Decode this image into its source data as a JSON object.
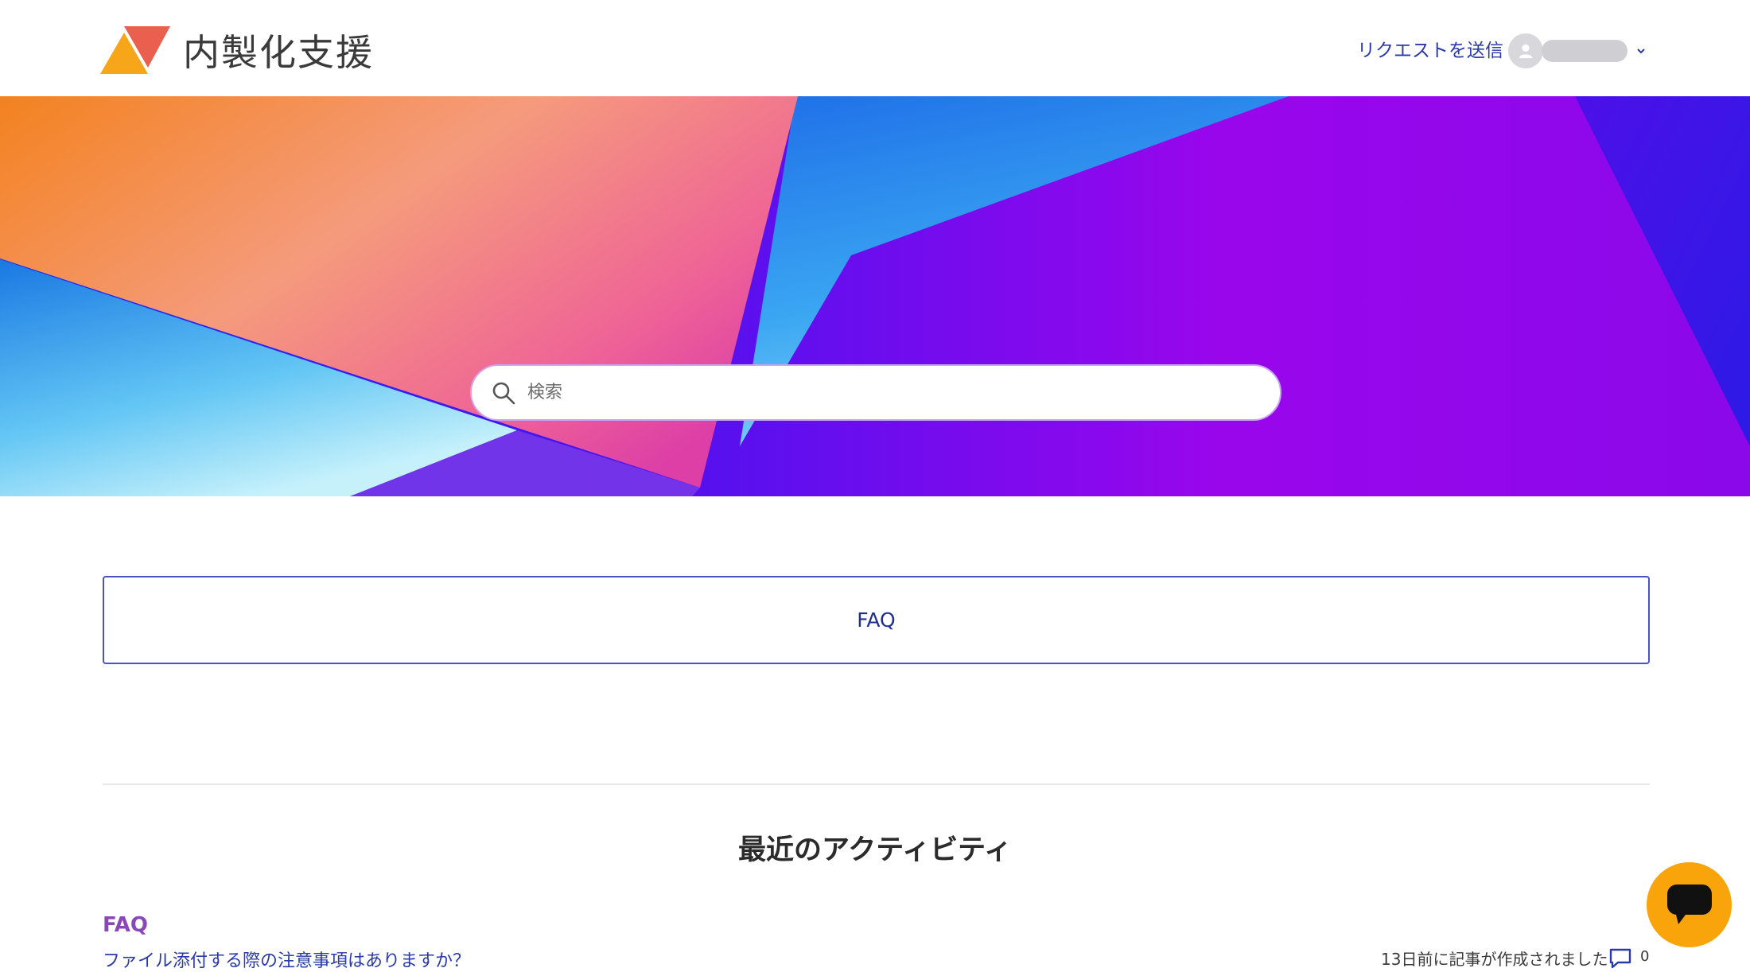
{
  "header": {
    "brand_name": "内製化支援",
    "request_link": "リクエストを送信",
    "user_menu_icon": "chevron-down-icon",
    "logo_colors": {
      "left": "#f7a61a",
      "right": "#e9604f"
    }
  },
  "hero": {
    "search_placeholder": "検索",
    "search_icon": "search-icon"
  },
  "faq_block": {
    "label": "FAQ"
  },
  "recent_activity": {
    "title": "最近のアクティビティ",
    "items": [
      {
        "section": "FAQ",
        "article": "ファイル添付する際の注意事項はありますか？",
        "meta": "13日前に記事が作成されました",
        "comment_count": "0"
      }
    ]
  },
  "chat": {
    "icon": "chat-icon",
    "color": "#f9a40b"
  },
  "colors": {
    "link": "#2a3aa8",
    "faq_border": "#4b52c6",
    "section_label": "#8a47b8"
  }
}
